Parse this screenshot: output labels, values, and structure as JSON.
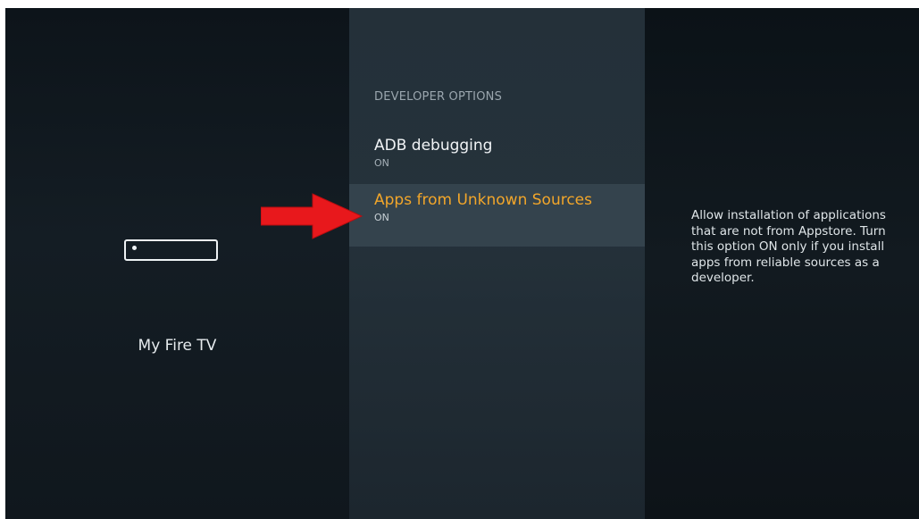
{
  "left_panel": {
    "device_name": "My Fire TV",
    "icon": "fire-tv-stick-icon"
  },
  "middle_panel": {
    "section_header": "DEVELOPER OPTIONS",
    "items": [
      {
        "label": "ADB debugging",
        "status": "ON"
      },
      {
        "label": "Apps from Unknown Sources",
        "status": "ON",
        "selected": true
      }
    ]
  },
  "right_panel": {
    "description": "Allow installation of applications that are not from Appstore. Turn this option ON only if you install apps from reliable sources as a developer."
  },
  "annotation": {
    "icon": "red-arrow-icon",
    "color": "#e8181c"
  },
  "colors": {
    "accent": "#f2a62a",
    "selected_bg": "#34434d",
    "text": "#f1f4f6"
  }
}
